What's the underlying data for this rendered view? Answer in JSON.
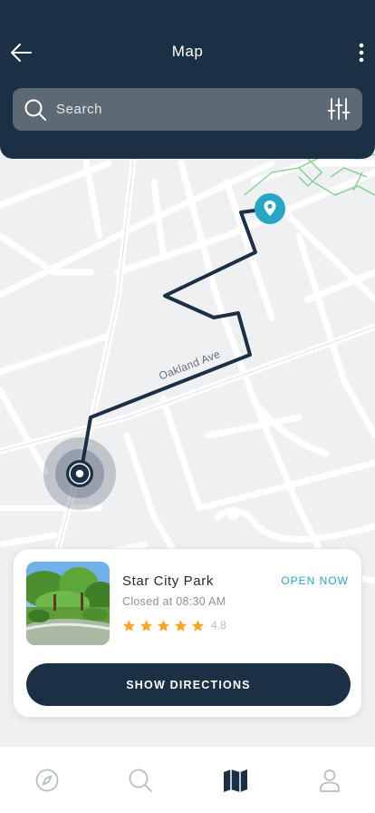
{
  "header": {
    "title": "Map"
  },
  "search": {
    "placeholder": "Search"
  },
  "map": {
    "street_label": "Oakland Ave"
  },
  "place": {
    "name": "Star City Park",
    "status": "OPEN NOW",
    "closing": "Closed at 08:30 AM",
    "rating": "4.8",
    "stars_filled": 5
  },
  "card": {
    "directions_label": "SHOW DIRECTIONS"
  },
  "tabs": [
    {
      "icon": "compass-icon",
      "active": false
    },
    {
      "icon": "search-icon",
      "active": false
    },
    {
      "icon": "map-icon",
      "active": true
    },
    {
      "icon": "profile-icon",
      "active": false
    }
  ],
  "colors": {
    "primary": "#1b2f45",
    "accent": "#27a7c4",
    "star": "#f5a623",
    "map_bg": "#eef0f1"
  }
}
